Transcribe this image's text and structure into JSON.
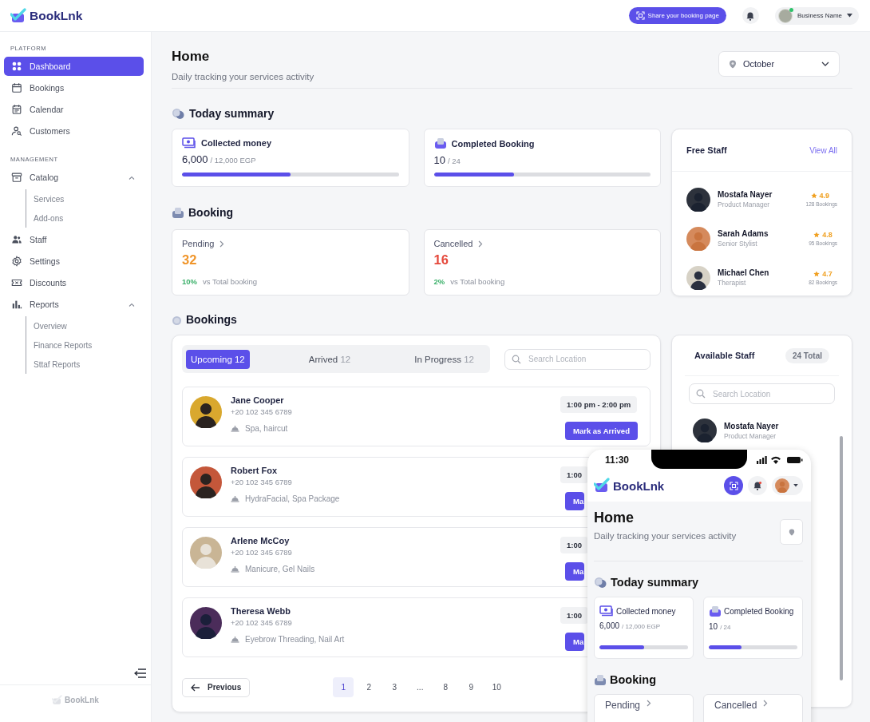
{
  "brand": {
    "name": "BookLnk"
  },
  "topbar": {
    "share_button": "Share your booking page",
    "account": {
      "name": "Business Name",
      "online": true
    }
  },
  "sidebar": {
    "sections": [
      {
        "title": "PLATFORM",
        "items": [
          {
            "label": "Dashboard",
            "selected": true
          },
          {
            "label": "Bookings",
            "selected": false
          },
          {
            "label": "Calendar",
            "selected": false
          },
          {
            "label": "Customers",
            "selected": false
          }
        ]
      },
      {
        "title": "MANAGEMENT",
        "items": [
          {
            "label": "Catalog",
            "selected": false,
            "expanded": true,
            "children": [
              {
                "label": "Services",
                "selected": false
              },
              {
                "label": "Add-ons",
                "selected": false
              }
            ]
          },
          {
            "label": "Staff",
            "selected": false
          },
          {
            "label": "Settings",
            "selected": false
          },
          {
            "label": "Discounts",
            "selected": false
          },
          {
            "label": "Reports",
            "selected": false,
            "expanded": true,
            "children": [
              {
                "label": "Overview",
                "selected": false
              },
              {
                "label": "Finance Reports",
                "selected": false
              },
              {
                "label": "Sttaf Reports",
                "selected": false
              }
            ]
          }
        ]
      }
    ],
    "footer_brand": "BookLnk"
  },
  "header": {
    "title": "Home",
    "subtitle": "Daily tracking your services activity",
    "month": "October"
  },
  "today_summary": {
    "title": "Today summary",
    "cards": [
      {
        "label": "Collected money",
        "value": "6,000",
        "total": "/ 12,000 EGP",
        "level": 0.5
      },
      {
        "label": "Completed Booking",
        "value": "10",
        "total": "/ 24",
        "level": 0.37
      }
    ]
  },
  "booking": {
    "title": "Booking",
    "cards": [
      {
        "label": "Pending",
        "value": "32",
        "color": "#f0952a",
        "change": "10%",
        "change_label": "vs Total booking"
      },
      {
        "label": "Cancelled",
        "value": "16",
        "color": "#e5483b",
        "change": "2%",
        "change_label": "vs Total booking"
      }
    ]
  },
  "bookings": {
    "title": "Bookings",
    "tabs": [
      {
        "label": "Upcoming",
        "count": "12",
        "selected": true
      },
      {
        "label": "Arrived",
        "count": "12",
        "selected": false
      },
      {
        "label": "In Progress",
        "count": "12",
        "selected": false
      }
    ],
    "search_placeholder": "Search Location",
    "items": [
      {
        "name": "Jane Cooper",
        "phone": "+20 102 345 6789",
        "services": "Spa, haircut",
        "time": "1:00 pm - 2:00 pm",
        "action": "Mark as Arrived"
      },
      {
        "name": "Robert Fox",
        "phone": "+20 102 345 6789",
        "services": "HydraFacial, Spa Package",
        "time": "1:00",
        "action": "Ma"
      },
      {
        "name": "Arlene McCoy",
        "phone": "+20 102 345 6789",
        "services": "Manicure, Gel Nails",
        "time": "1:00",
        "action": "Ma"
      },
      {
        "name": "Theresa Webb",
        "phone": "+20 102 345 6789",
        "services": "Eyebrow Threading, Nail Art",
        "time": "1:00",
        "action": "Ma"
      }
    ],
    "pagination": {
      "previous": "Previous",
      "pages": [
        {
          "label": "1",
          "selected": true
        },
        {
          "label": "2",
          "selected": false
        },
        {
          "label": "3",
          "selected": false
        },
        {
          "label": "...",
          "selected": false
        },
        {
          "label": "8",
          "selected": false
        },
        {
          "label": "9",
          "selected": false
        },
        {
          "label": "10",
          "selected": false
        }
      ]
    }
  },
  "free_staff": {
    "title": "Free Staff",
    "link": "View All",
    "staff": [
      {
        "name": "Mostafa Nayer",
        "role": "Product Manager",
        "rating": "4.9",
        "bookings": "128 Bookings"
      },
      {
        "name": "Sarah Adams",
        "role": "Senior Stylist",
        "rating": "4.8",
        "bookings": "95 Bookings"
      },
      {
        "name": "Michael Chen",
        "role": "Therapist",
        "rating": "4.7",
        "bookings": "82 Bookings"
      }
    ]
  },
  "available_staff": {
    "title": "Available Staff",
    "total": "24 Total",
    "search_placeholder": "Search Location",
    "staff": [
      {
        "name": "Mostafa Nayer",
        "role": "Product Manager"
      }
    ]
  },
  "phone": {
    "time": "11:30",
    "brand": "BookLnk",
    "title": "Home",
    "subtitle": "Daily tracking your services activity",
    "summary_title": "Today summary",
    "cards": [
      {
        "label": "Collected money",
        "value": "6,000",
        "total": "/ 12,000 EGP",
        "level": 0.5
      },
      {
        "label": "Completed Booking",
        "value": "10",
        "total": "/ 24",
        "level": 0.37
      }
    ],
    "booking_title": "Booking",
    "booking_cards": [
      {
        "label": "Pending"
      },
      {
        "label": "Cancelled"
      }
    ]
  }
}
